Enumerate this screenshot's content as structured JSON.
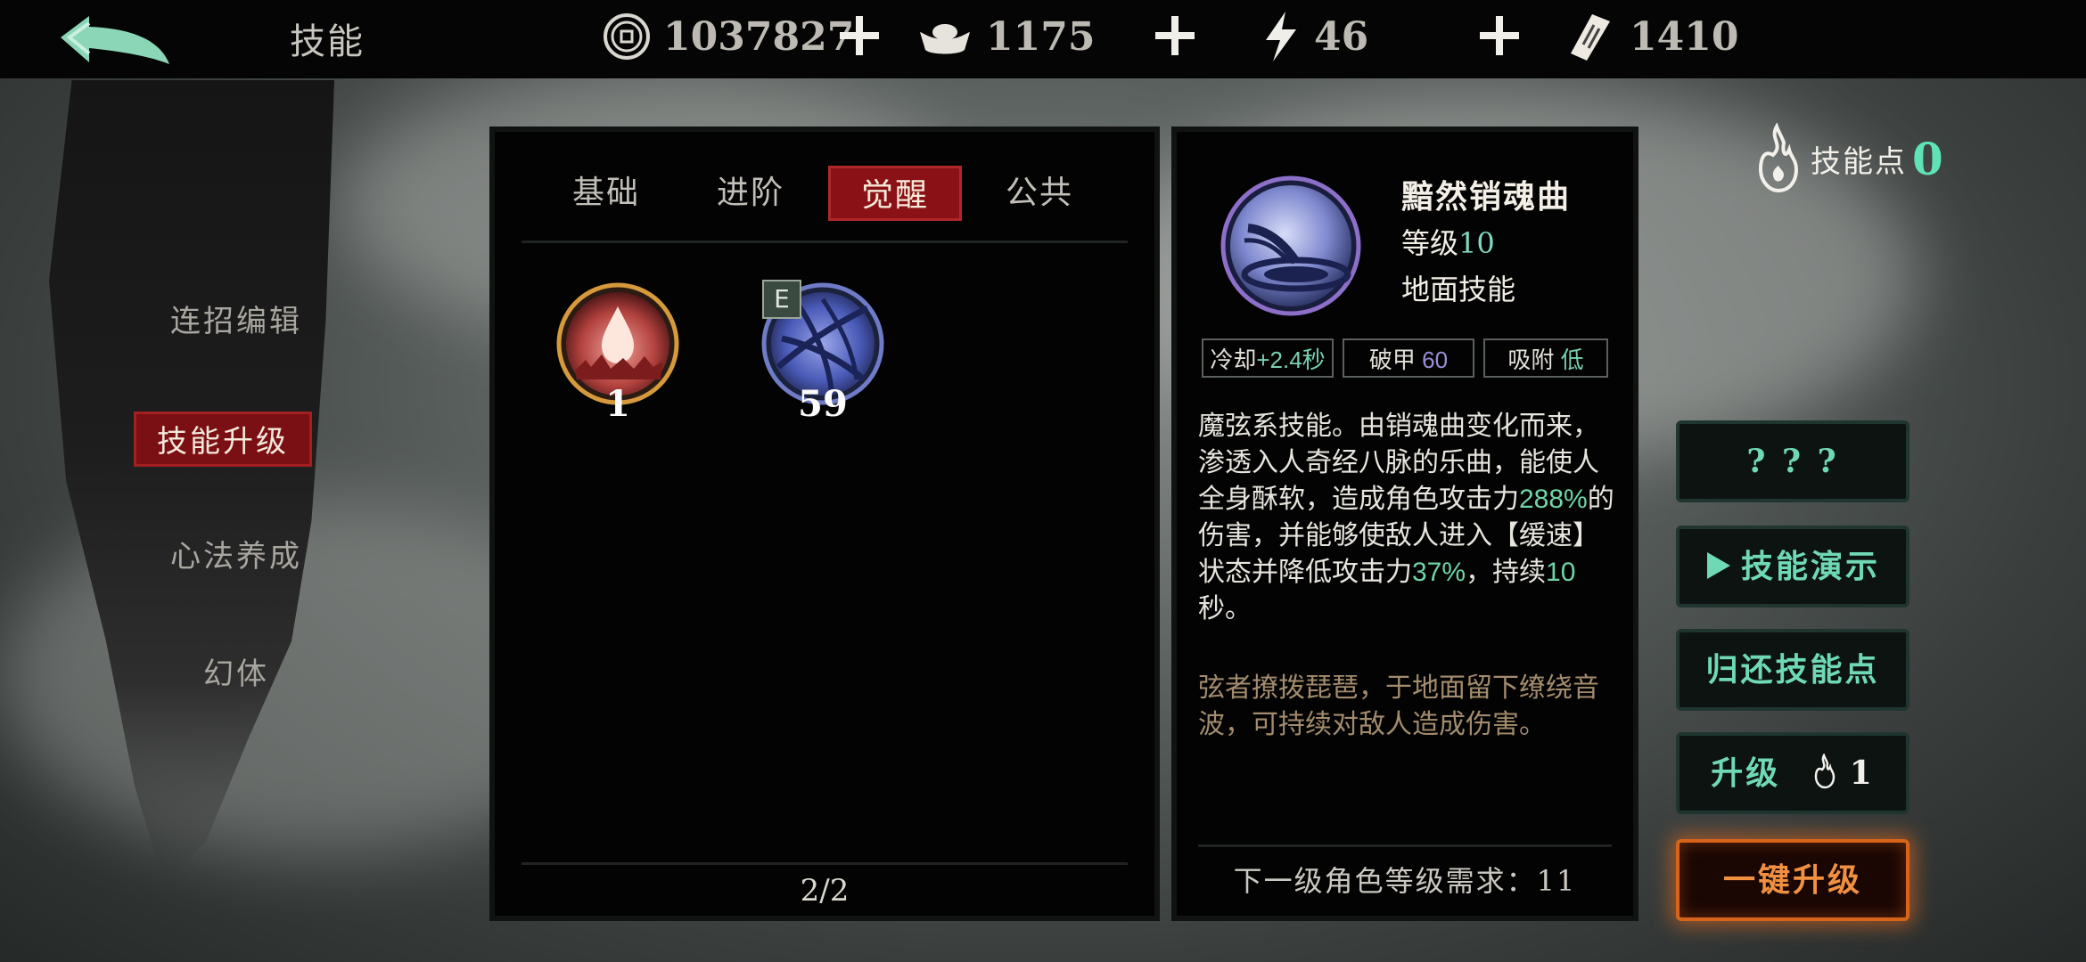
{
  "header": {
    "title": "技能",
    "currencies": [
      {
        "icon": "coin-icon",
        "value": "1037827"
      },
      {
        "icon": "silver-ingot-icon",
        "value": "1175"
      },
      {
        "icon": "energy-bolt-icon",
        "value": "46"
      },
      {
        "icon": "talisman-icon",
        "value": "1410"
      }
    ]
  },
  "sidebar": {
    "items": [
      {
        "label": "连招编辑",
        "active": false
      },
      {
        "label": "技能升级",
        "active": true
      },
      {
        "label": "心法养成",
        "active": false
      },
      {
        "label": "幻体",
        "active": false
      }
    ]
  },
  "skills_panel": {
    "tabs": [
      {
        "label": "基础",
        "active": false
      },
      {
        "label": "进阶",
        "active": false
      },
      {
        "label": "觉醒",
        "active": true
      },
      {
        "label": "公共",
        "active": false
      }
    ],
    "skills": [
      {
        "icon": "blood-drop-skill-icon",
        "count": "1",
        "badge": ""
      },
      {
        "icon": "strings-skill-icon",
        "count": "59",
        "badge": "E"
      }
    ],
    "page": "2/2"
  },
  "detail": {
    "name": "黯然销魂曲",
    "level_label": "等级",
    "level_value": "10",
    "type": "地面技能",
    "stats": [
      {
        "label": "冷却",
        "value": "+2.4秒"
      },
      {
        "label": "破甲",
        "value": "60"
      },
      {
        "label": "吸附",
        "value": "低"
      }
    ],
    "description": [
      {
        "t": "魔弦系技能。由销魂曲变化而来，渗透入人奇经八脉的乐曲，能使人全身酥软，造成角色攻击力",
        "hl": false
      },
      {
        "t": "288%",
        "hl": true
      },
      {
        "t": "的伤害，并能够使敌人进入【缓速】状态并降低攻击力",
        "hl": false
      },
      {
        "t": "37%",
        "hl": true
      },
      {
        "t": "，持续",
        "hl": false
      },
      {
        "t": "10",
        "hl": true
      },
      {
        "t": "秒。",
        "hl": false
      }
    ],
    "flavor": "弦者撩拨琵琶，于地面留下缭绕音波，可持续对敌人造成伤害。",
    "requirement_label": "下一级角色等级需求：",
    "requirement_value": "11"
  },
  "skill_points": {
    "label": "技能点",
    "value": "0"
  },
  "actions": {
    "unknown": "? ? ?",
    "demo": "技能演示",
    "refund": "归还技能点",
    "upgrade_label": "升级",
    "upgrade_cost": "1",
    "one_click": "一键升级"
  },
  "colors": {
    "accent_teal": "#6fd9b6",
    "active_red": "#8a1216",
    "orange": "#e8742a"
  }
}
